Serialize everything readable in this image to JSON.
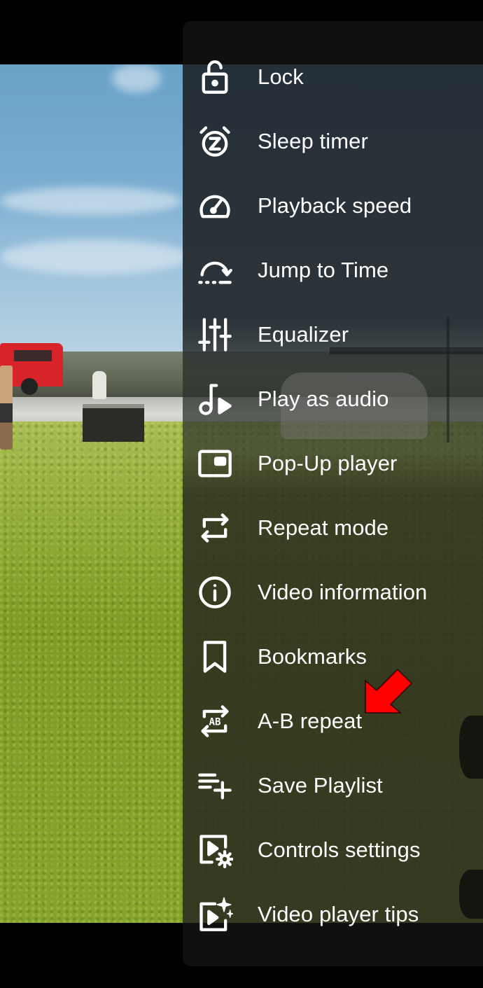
{
  "menu": {
    "items": [
      {
        "label": "Lock",
        "icon": "lock-open-icon"
      },
      {
        "label": "Sleep timer",
        "icon": "sleep-timer-icon"
      },
      {
        "label": "Playback speed",
        "icon": "speedometer-icon"
      },
      {
        "label": "Jump to Time",
        "icon": "jump-to-time-icon"
      },
      {
        "label": "Equalizer",
        "icon": "equalizer-icon"
      },
      {
        "label": "Play as audio",
        "icon": "music-play-icon"
      },
      {
        "label": "Pop-Up player",
        "icon": "picture-in-picture-icon"
      },
      {
        "label": "Repeat mode",
        "icon": "repeat-icon"
      },
      {
        "label": "Video information",
        "icon": "info-icon"
      },
      {
        "label": "Bookmarks",
        "icon": "bookmark-icon"
      },
      {
        "label": "A-B repeat",
        "icon": "ab-repeat-icon"
      },
      {
        "label": "Save Playlist",
        "icon": "playlist-add-icon"
      },
      {
        "label": "Controls settings",
        "icon": "video-settings-icon"
      },
      {
        "label": "Video player tips",
        "icon": "video-sparkle-icon"
      }
    ]
  },
  "annotation": {
    "type": "arrow",
    "points_to": "A-B repeat",
    "color": "#ff0000"
  },
  "colors": {
    "icon": "#ffffff",
    "text": "#ffffff",
    "panel_edge": "#101010"
  }
}
